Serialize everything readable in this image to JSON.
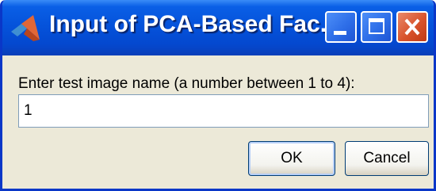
{
  "dialog": {
    "title": "Input of PCA-Based Fac...",
    "app_icon": "matlab-icon",
    "caption_buttons": [
      "minimize-icon",
      "maximize-icon",
      "close-icon"
    ],
    "prompt": "Enter test image name (a number between 1 to 4):",
    "input_value": "1",
    "ok_label": "OK",
    "cancel_label": "Cancel"
  },
  "colors": {
    "titlebar": "#0553db",
    "window_body": "#ece9d8",
    "close_button": "#d8532c"
  }
}
